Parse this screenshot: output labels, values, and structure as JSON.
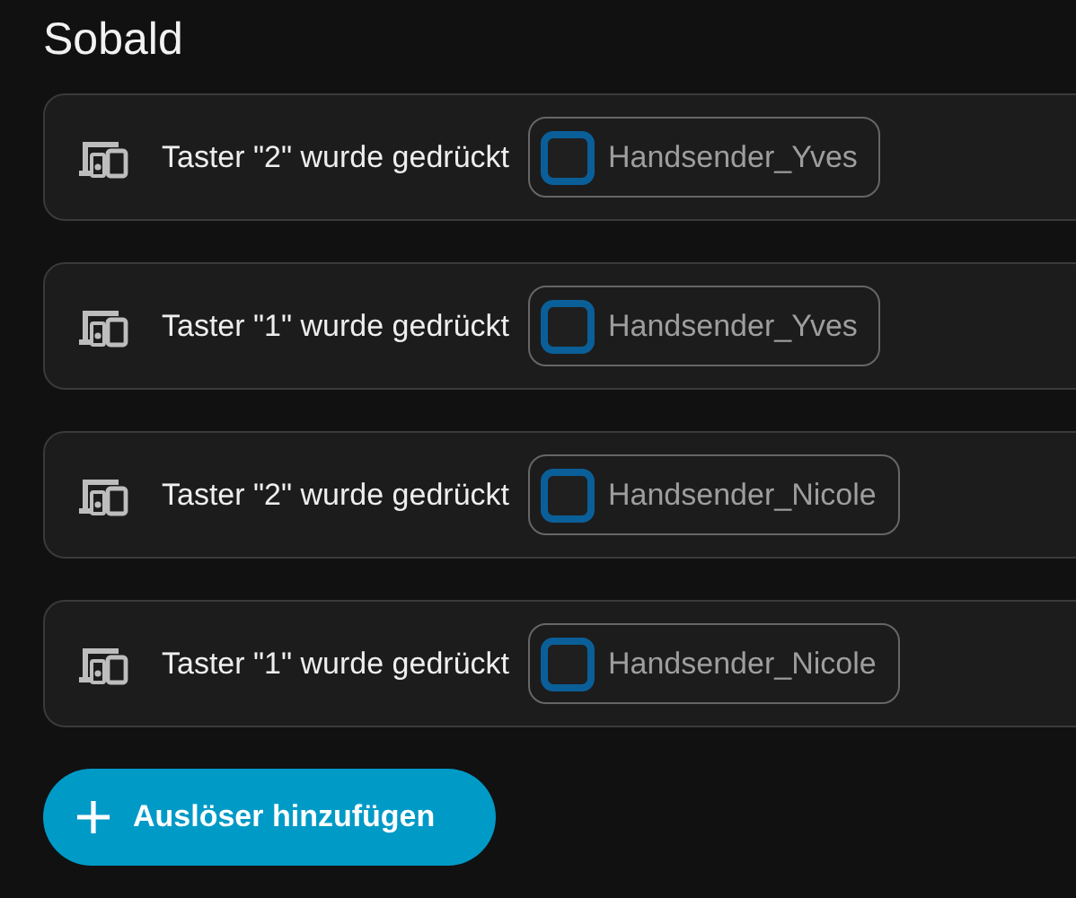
{
  "heading": "Sobald",
  "triggers": [
    {
      "label": "Taster \"2\" wurde gedrückt",
      "device": "Handsender_Yves"
    },
    {
      "label": "Taster \"1\" wurde gedrückt",
      "device": "Handsender_Yves"
    },
    {
      "label": "Taster \"2\" wurde gedrückt",
      "device": "Handsender_Nicole"
    },
    {
      "label": "Taster \"1\" wurde gedrückt",
      "device": "Handsender_Nicole"
    }
  ],
  "add_button": {
    "label": "Auslöser hinzufügen"
  }
}
